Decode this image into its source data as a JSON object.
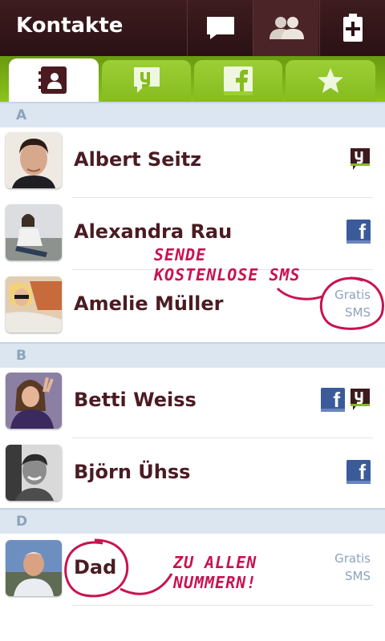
{
  "header": {
    "title": "Kontakte",
    "icons": [
      "chat-icon",
      "contacts-icon",
      "battery-add-icon"
    ]
  },
  "tabs": [
    {
      "name": "address-book",
      "icon": "address-book-icon",
      "active": true
    },
    {
      "name": "yak",
      "icon": "yak-icon",
      "active": false
    },
    {
      "name": "facebook",
      "icon": "facebook-icon",
      "active": false
    },
    {
      "name": "favorites",
      "icon": "star-icon",
      "active": false
    }
  ],
  "sections": [
    {
      "letter": "A",
      "contacts": [
        {
          "name": "Albert Seitz",
          "badges": [
            "yak"
          ]
        },
        {
          "name": "Alexandra Rau",
          "badges": [
            "facebook"
          ]
        },
        {
          "name": "Amelie Müller",
          "gratis": [
            "Gratis",
            "SMS"
          ]
        }
      ]
    },
    {
      "letter": "B",
      "contacts": [
        {
          "name": "Betti Weiss",
          "badges": [
            "facebook",
            "yak"
          ]
        },
        {
          "name": "Björn Ühss",
          "badges": [
            "facebook"
          ]
        }
      ]
    },
    {
      "letter": "D",
      "contacts": [
        {
          "name": "Dad",
          "gratis": [
            "Gratis",
            "SMS"
          ]
        }
      ]
    }
  ],
  "annotations": {
    "sms_line1": "SENDE",
    "sms_line2": "KOSTENLOSE SMS",
    "dad_line1": "ZU ALLEN",
    "dad_line2": "NUMMERN!"
  },
  "colors": {
    "header": "#2a1114",
    "tab_green": "#8bc320",
    "name": "#4a1c22",
    "section": "#dce6f0",
    "facebook": "#3b5a99",
    "annotation": "#c8134f"
  }
}
